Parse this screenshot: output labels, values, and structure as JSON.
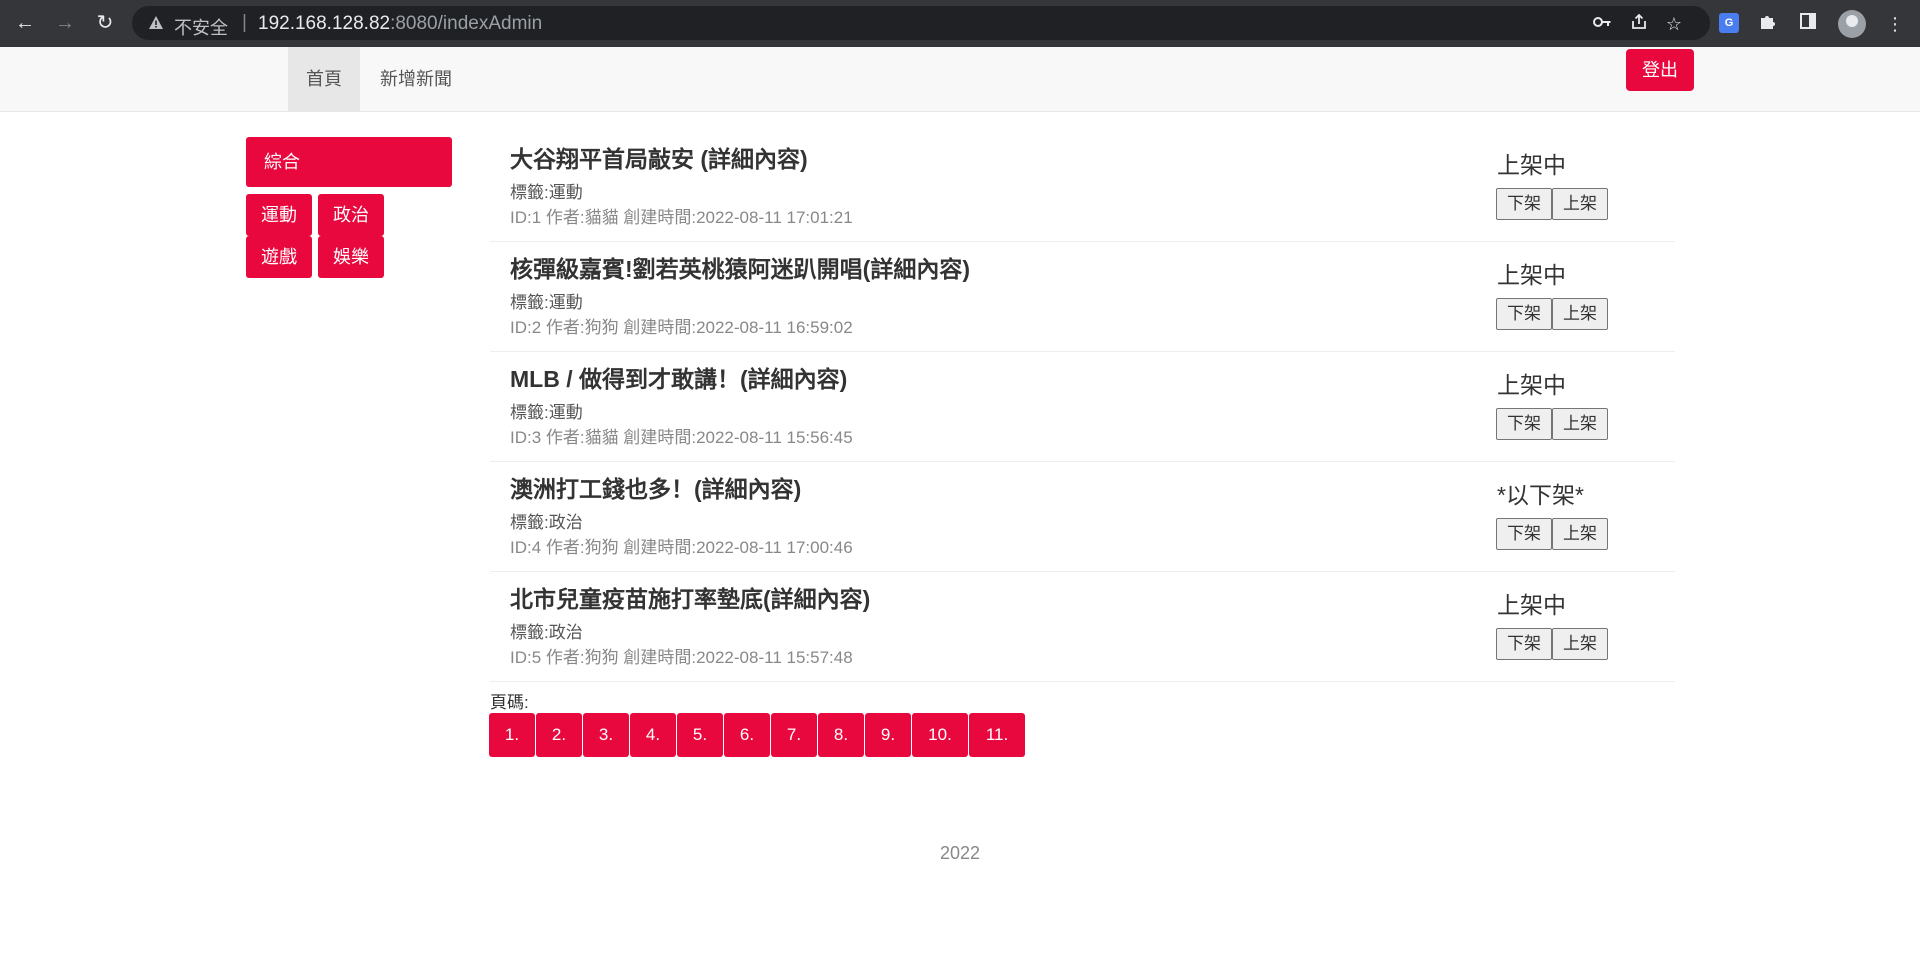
{
  "browser": {
    "insecure_label": "不安全",
    "url_host": "192.168.128.82",
    "url_rest": ":8080/indexAdmin"
  },
  "navbar": {
    "home": "首頁",
    "add_news": "新增新聞",
    "logout": "登出"
  },
  "categories": {
    "all": "綜合",
    "sports": "運動",
    "politics": "政治",
    "games": "遊戲",
    "entertainment": "娛樂"
  },
  "news": [
    {
      "title": "大谷翔平首局敲安 (詳細內容)",
      "tag": "標籤:運動",
      "meta": "ID:1 作者:貓貓 創建時間:2022-08-11 17:01:21",
      "status": "上架中",
      "btn_off": "下架",
      "btn_on": "上架"
    },
    {
      "title": "核彈級嘉賓!劉若英桃猿阿迷趴開唱(詳細內容)",
      "tag": "標籤:運動",
      "meta": "ID:2 作者:狗狗 創建時間:2022-08-11 16:59:02",
      "status": "上架中",
      "btn_off": "下架",
      "btn_on": "上架"
    },
    {
      "title": "MLB / 做得到才敢講！(詳細內容)",
      "tag": "標籤:運動",
      "meta": "ID:3 作者:貓貓 創建時間:2022-08-11 15:56:45",
      "status": "上架中",
      "btn_off": "下架",
      "btn_on": "上架"
    },
    {
      "title": "澳洲打工錢也多！(詳細內容)",
      "tag": "標籤:政治",
      "meta": "ID:4 作者:狗狗 創建時間:2022-08-11 17:00:46",
      "status": "*以下架*",
      "btn_off": "下架",
      "btn_on": "上架"
    },
    {
      "title": "北市兒童疫苗施打率墊底(詳細內容)",
      "tag": "標籤:政治",
      "meta": "ID:5 作者:狗狗 創建時間:2022-08-11 15:57:48",
      "status": "上架中",
      "btn_off": "下架",
      "btn_on": "上架"
    }
  ],
  "pagination": {
    "label": "頁碼:",
    "pages": [
      "1.",
      "2.",
      "3.",
      "4.",
      "5.",
      "6.",
      "7.",
      "8.",
      "9.",
      "10.",
      "11."
    ]
  },
  "footer": {
    "text": "2022"
  },
  "colors": {
    "accent": "#e8083e",
    "chrome": "#35363a",
    "omnibox": "#202124"
  }
}
